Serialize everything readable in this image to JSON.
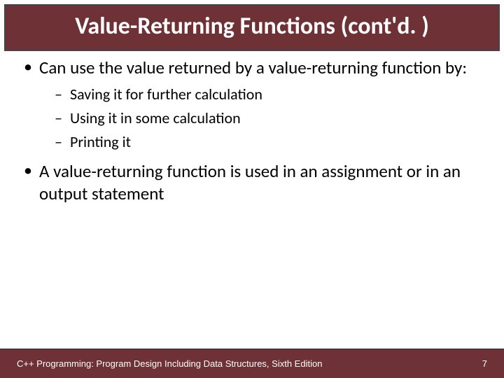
{
  "title": "Value-Returning Functions (cont'd. )",
  "bullets": [
    {
      "text": "Can use the value returned by a value-returning function by:",
      "sub": [
        "Saving it for further calculation",
        "Using it in some calculation",
        "Printing it"
      ]
    },
    {
      "text": "A value-returning function is used in an assignment or in an output statement",
      "sub": []
    }
  ],
  "footer": {
    "text": "C++ Programming: Program Design Including Data Structures, Sixth Edition",
    "page": "7"
  }
}
